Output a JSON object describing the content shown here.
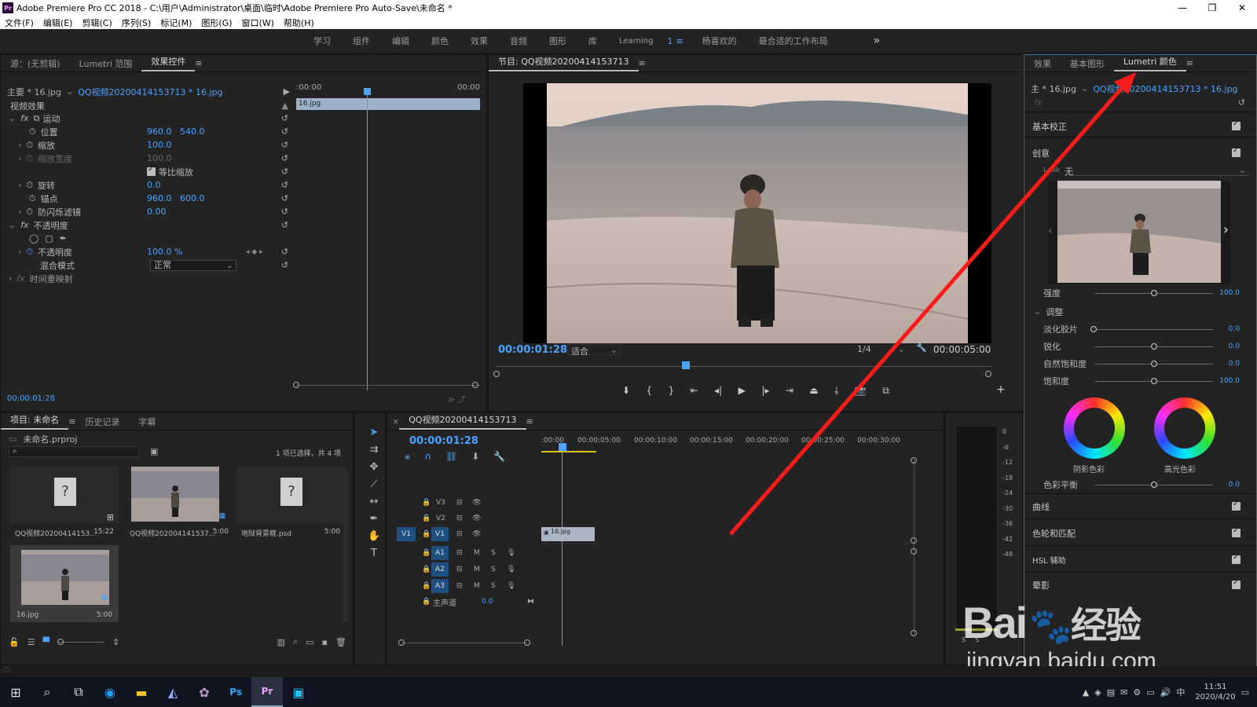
{
  "window": {
    "title": "Adobe Premiere Pro CC 2018 - C:\\用户\\Administrator\\桌面\\临时\\Adobe Premiere Pro Auto-Save\\未命名 *",
    "app_icon": "Pr",
    "controls": [
      "—",
      "❐",
      "✕"
    ]
  },
  "menu": [
    "文件(F)",
    "编辑(E)",
    "剪辑(C)",
    "序列(S)",
    "标记(M)",
    "图形(G)",
    "窗口(W)",
    "帮助(H)"
  ],
  "workspaces": {
    "items": [
      "学习",
      "组件",
      "编辑",
      "颜色",
      "效果",
      "音频",
      "图形",
      "库",
      "Learning"
    ],
    "active_marker": "1",
    "extra": [
      "杨喜欢的",
      "最合适的工作布局"
    ],
    "overflow": "»"
  },
  "source_panel": {
    "tabs": [
      "源：(无剪辑)",
      "Lumetri 范围",
      "效果控件"
    ],
    "master_label": "主要 * 16.jpg",
    "clip_label": "QQ视频20200414153713 * 16.jpg",
    "tl_start": ":00:00",
    "tl_end": "00:00",
    "clip_bar": "16.jpg",
    "section": "视频效果",
    "motion": "运动",
    "position_label": "位置",
    "position_x": "960.0",
    "position_y": "540.0",
    "scale_label": "缩放",
    "scale_value": "100.0",
    "scale_width_label": "缩放宽度",
    "scale_width_value": "100.0",
    "uniform_label": "等比缩放",
    "rotation_label": "旋转",
    "rotation_value": "0.0",
    "anchor_label": "锚点",
    "anchor_x": "960.0",
    "anchor_y": "600.0",
    "flicker_label": "防闪烁滤镜",
    "flicker_value": "0.00",
    "opacity_section": "不透明度",
    "opacity_label": "不透明度",
    "opacity_value": "100.0 %",
    "blend_label": "混合模式",
    "blend_value": "正常",
    "time_remap": "时间重映射",
    "timecode": "00:00:01:28"
  },
  "program_monitor": {
    "title": "节目: QQ视频20200414153713",
    "timecode": "00:00:01:28",
    "fit": "适合",
    "quality": "1/4",
    "duration": "00:00:05:00"
  },
  "project_panel": {
    "tabs": [
      "项目: 未命名",
      "历史记录",
      "字幕"
    ],
    "file": "未命名.prproj",
    "status": "1 项已选择，共 4 项",
    "items": [
      {
        "name": "QQ视频20200414153...",
        "duration": "15:22"
      },
      {
        "name": "QQ视频202004141537...",
        "duration": "5:00"
      },
      {
        "name": "地狱背景框.psd",
        "duration": "5:00"
      },
      {
        "name": "16.jpg",
        "duration": "5:00"
      }
    ]
  },
  "timeline": {
    "title": "QQ视频20200414153713",
    "timecode": "00:00:01:28",
    "ruler": [
      ":00:00",
      "00:00:05:00",
      "00:00:10:00",
      "00:00:15:00",
      "00:00:20:00",
      "00:00:25:00",
      "00:00:30:00"
    ],
    "video_tracks": [
      "V3",
      "V2",
      "V1"
    ],
    "source_patch": "V1",
    "audio_tracks": [
      "A1",
      "A2",
      "A3"
    ],
    "master": "主声道",
    "master_value": "0.0",
    "clip": "16.jpg",
    "track_btn_m": "M",
    "track_btn_s": "S"
  },
  "meter": {
    "scale": [
      "0",
      "-6",
      "-12",
      "-18",
      "-24",
      "-30",
      "-36",
      "-42",
      "-48"
    ],
    "solo": [
      "S",
      "S"
    ]
  },
  "lumetri": {
    "tabs": [
      "效果",
      "基本图形",
      "Lumetri 颜色"
    ],
    "master_label": "主 * 16.jpg",
    "clip_label": "QQ视频20200414153713 * 16.jpg",
    "fx": "fx",
    "basic_correction": "基本校正",
    "creative": "创意",
    "look_label": "Look",
    "look_value": "无",
    "intensity_label": "强度",
    "intensity_value": "100.0",
    "adjust_label": "调整",
    "faded_film_label": "淡化胶片",
    "faded_film_value": "0.0",
    "sharpen_label": "锐化",
    "sharpen_value": "0.0",
    "vibrance_label": "自然饱和度",
    "vibrance_value": "0.0",
    "saturation_label": "饱和度",
    "saturation_value": "100.0",
    "shadow_tint": "阴影色彩",
    "highlight_tint": "高光色彩",
    "tint_balance_label": "色彩平衡",
    "tint_balance_value": "0.0",
    "curves": "曲线",
    "color_wheels": "色轮和匹配",
    "hsl": "HSL 辅助",
    "vignette": "晕影"
  },
  "watermark": {
    "brand": "Bai",
    "brand_suffix": "经验",
    "url": "jingyan.baidu.com"
  },
  "taskbar": {
    "time": "11:51",
    "date": "2020/4/20",
    "ime": "中"
  },
  "colors": {
    "accent": "#4aa3ff",
    "arrow": "#ff1a1a"
  }
}
